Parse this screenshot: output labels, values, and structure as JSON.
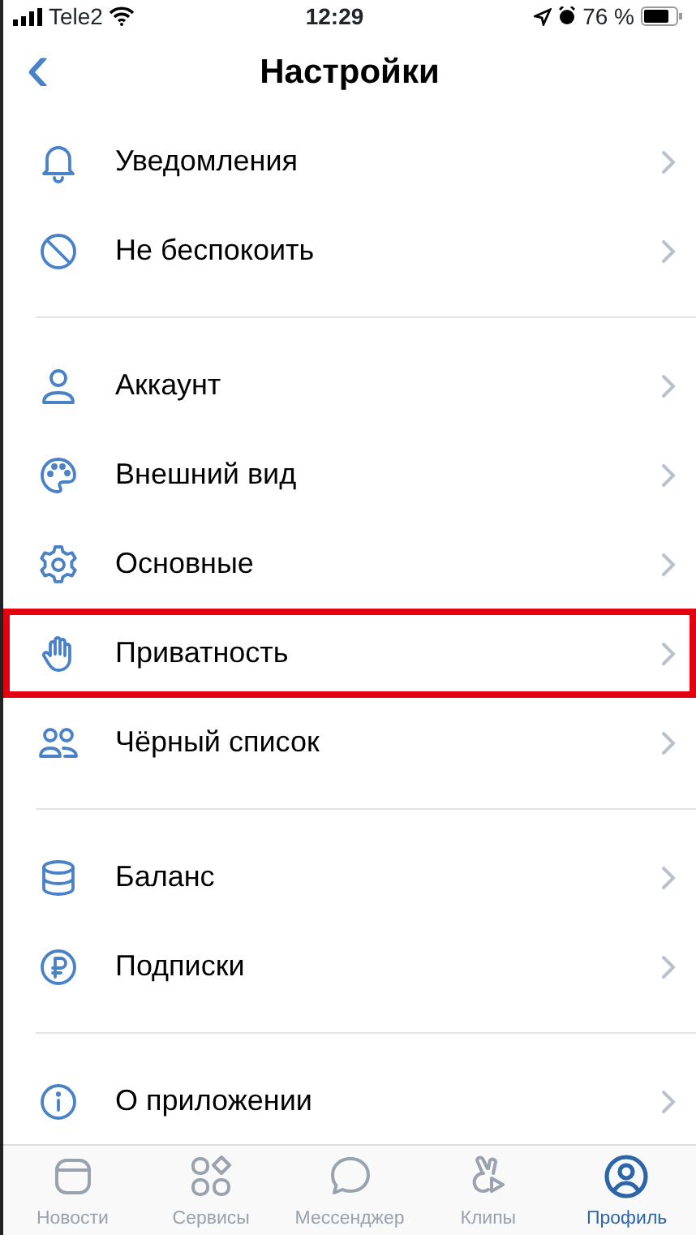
{
  "status_bar": {
    "carrier": "Tele2",
    "time": "12:29",
    "battery": "76 %"
  },
  "header": {
    "back": "‹",
    "title": "Настройки"
  },
  "groups": [
    {
      "items": [
        {
          "label": "Уведомления",
          "highlighted": false
        },
        {
          "label": "Не беспокоить",
          "highlighted": false
        }
      ]
    },
    {
      "items": [
        {
          "label": "Аккаунт",
          "highlighted": false
        },
        {
          "label": "Внешний вид",
          "highlighted": false
        },
        {
          "label": "Основные",
          "highlighted": false
        },
        {
          "label": "Приватность",
          "highlighted": true
        },
        {
          "label": "Чёрный список",
          "highlighted": false
        }
      ]
    },
    {
      "items": [
        {
          "label": "Баланс",
          "highlighted": false
        },
        {
          "label": "Подписки",
          "highlighted": false
        }
      ]
    },
    {
      "items": [
        {
          "label": "О приложении",
          "highlighted": false
        }
      ]
    }
  ],
  "tabs": [
    {
      "label": "Новости",
      "selected": false
    },
    {
      "label": "Сервисы",
      "selected": false
    },
    {
      "label": "Мессенджер",
      "selected": false
    },
    {
      "label": "Клипы",
      "selected": false
    },
    {
      "label": "Профиль",
      "selected": true
    }
  ]
}
